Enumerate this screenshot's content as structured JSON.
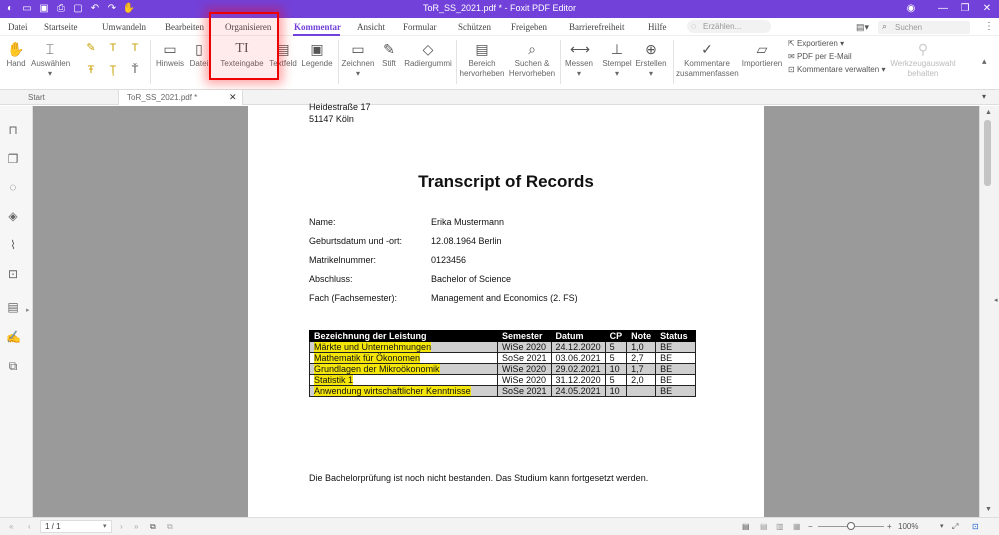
{
  "app": {
    "title": "ToR_SS_2021.pdf * - Foxit PDF Editor",
    "accent": "#7241d9"
  },
  "menu": {
    "items": [
      "Datei",
      "Startseite",
      "Umwandeln",
      "Bearbeiten",
      "Organisieren",
      "Kommentar",
      "Ansicht",
      "Formular",
      "Schützen",
      "Freigeben",
      "Barrierefreiheit",
      "Hilfe"
    ],
    "active": "Kommentar",
    "tell_me": "Erzählen...",
    "search_placeholder": "Suchen"
  },
  "ribbon": {
    "hand": "Hand",
    "select": "Auswählen",
    "note": "Hinweis",
    "file": "Datei",
    "typewriter": "Texteingabe",
    "textbox": "Textfeld",
    "callout": "Legende",
    "drawing": "Zeichnen",
    "pencil": "Stift",
    "eraser": "Radiergummi",
    "area_highlight_1": "Bereich",
    "area_highlight_2": "hervorheben",
    "search_highlight_1": "Suchen &",
    "search_highlight_2": "Hervorheben",
    "measure": "Messen",
    "stamp": "Stempel",
    "create": "Erstellen",
    "summarize_1": "Kommentare",
    "summarize_2": "zusammenfassen",
    "import": "Importieren",
    "export": "Exportieren",
    "email": "PDF per E-Mail",
    "manage": "Kommentare verwalten",
    "keep_tool_1": "Werkzeugauswahl",
    "keep_tool_2": "behalten"
  },
  "tabs": {
    "start": "Start",
    "doc": "ToR_SS_2021.pdf *"
  },
  "document": {
    "address1": "Heidestraße 17",
    "address2": "51147 Köln",
    "title": "Transcript of Records",
    "fields": [
      {
        "label": "Name:",
        "value": "Erika Mustermann"
      },
      {
        "label": "Geburtsdatum und -ort:",
        "value": "12.08.1964 Berlin"
      },
      {
        "label": "Matrikelnummer:",
        "value": "0123456"
      },
      {
        "label": "Abschluss:",
        "value": "Bachelor of Science"
      },
      {
        "label": "Fach (Fachsemester):",
        "value": "Management and Economics (2. FS)"
      }
    ],
    "table_headers": [
      "Bezeichnung der Leistung",
      "Semester",
      "Datum",
      "CP",
      "Note",
      "Status"
    ],
    "table_rows": [
      [
        "Märkte und Unternehmungen",
        "WiSe 2020",
        "24.12.2020",
        "5",
        "1,0",
        "BE"
      ],
      [
        "Mathematik für Ökonomen",
        "SoSe 2021",
        "03.06.2021",
        "5",
        "2,7",
        "BE"
      ],
      [
        "Grundlagen der Mikroökonomik",
        "WiSe 2020",
        "29.02.2021",
        "10",
        "1,7",
        "BE"
      ],
      [
        "Statistik 1",
        "WiSe 2020",
        "31.12.2020",
        "5",
        "2,0",
        "BE"
      ],
      [
        "Anwendung wirtschaftlicher Kenntnisse",
        "SoSe 2021",
        "24.05.2021",
        "10",
        "",
        "BE"
      ]
    ],
    "footer": "Die Bachelorprüfung ist noch nicht bestanden. Das Studium kann fortgesetzt werden."
  },
  "status": {
    "page": "1 / 1",
    "zoom": "100%"
  }
}
